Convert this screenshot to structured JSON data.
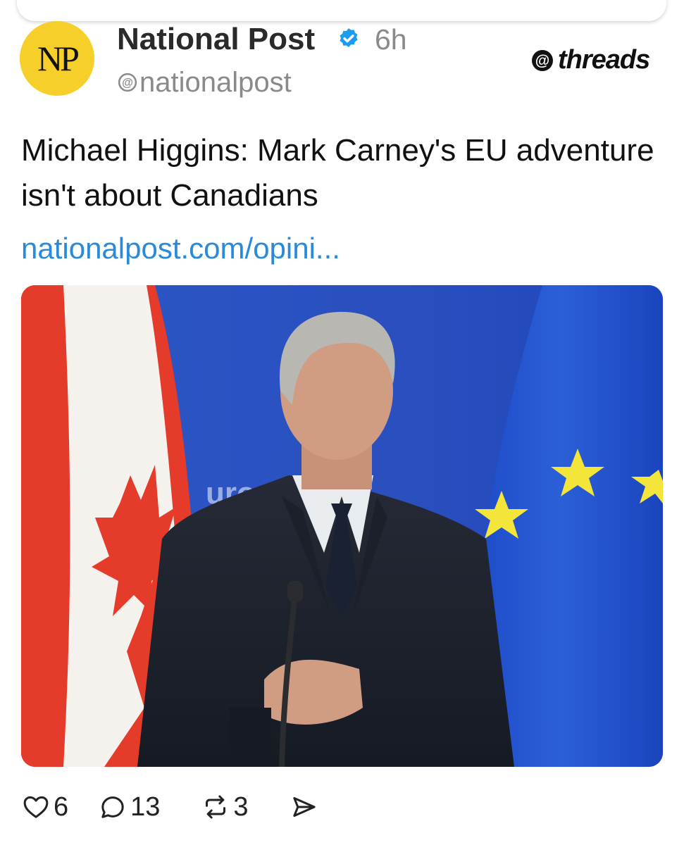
{
  "post": {
    "account_name": "National Post",
    "time_ago": "6h",
    "handle": "nationalpost",
    "avatar_text": "NP",
    "platform": "threads",
    "headline": "Michael Higgins: Mark Carney's EU adventure isn't about Canadians",
    "link_text": "nationalpost.com/opini...",
    "photo_backdrop_text": "uro"
  },
  "actions": {
    "likes": "6",
    "comments": "13",
    "reposts": "3"
  },
  "colors": {
    "avatar_bg": "#f6cf2a",
    "verified": "#1d9bf0",
    "link": "#2a8ad8",
    "eu_blue": "#1d4fc0",
    "canada_red": "#e43b2a",
    "eu_star": "#f4e53b"
  }
}
